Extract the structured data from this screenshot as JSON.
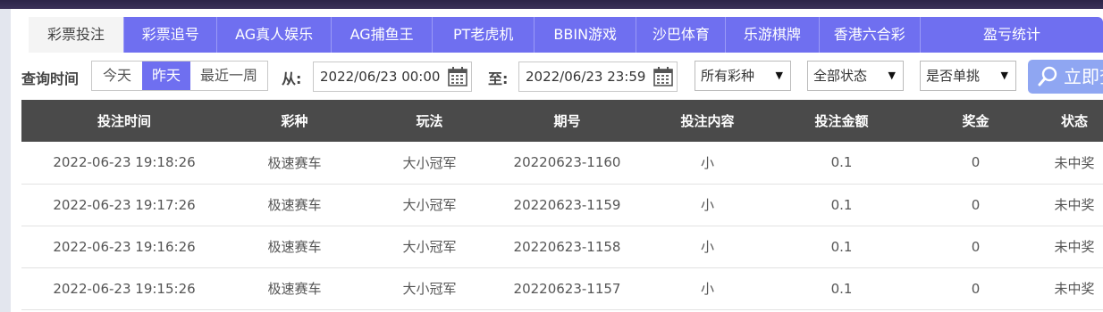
{
  "tabs": [
    {
      "label": "彩票投注",
      "active": true
    },
    {
      "label": "彩票追号",
      "active": false
    },
    {
      "label": "AG真人娱乐",
      "active": false
    },
    {
      "label": "AG捕鱼王",
      "active": false
    },
    {
      "label": "PT老虎机",
      "active": false
    },
    {
      "label": "BBIN游戏",
      "active": false
    },
    {
      "label": "沙巴体育",
      "active": false
    },
    {
      "label": "乐游棋牌",
      "active": false
    },
    {
      "label": "香港六合彩",
      "active": false
    },
    {
      "label": "盈亏统计",
      "active": false
    }
  ],
  "filter": {
    "query_time_label": "查询时间",
    "ranges": [
      {
        "label": "今天",
        "selected": false
      },
      {
        "label": "昨天",
        "selected": true
      },
      {
        "label": "最近一周",
        "selected": false
      }
    ],
    "from_label": "从:",
    "from_value": "2022/06/23 00:00",
    "to_label": "至:",
    "to_value": "2022/06/23 23:59",
    "lottery_type": "所有彩种",
    "status": "全部状态",
    "single_pick": "是否单挑",
    "search_label": "立即查"
  },
  "table": {
    "headers": [
      "投注时间",
      "彩种",
      "玩法",
      "期号",
      "投注内容",
      "投注金额",
      "奖金",
      "状态"
    ],
    "rows": [
      [
        "2022-06-23 19:18:26",
        "极速赛车",
        "大小冠军",
        "20220623-1160",
        "小",
        "0.1",
        "0",
        "未中奖"
      ],
      [
        "2022-06-23 19:17:26",
        "极速赛车",
        "大小冠军",
        "20220623-1159",
        "小",
        "0.1",
        "0",
        "未中奖"
      ],
      [
        "2022-06-23 19:16:26",
        "极速赛车",
        "大小冠军",
        "20220623-1158",
        "小",
        "0.1",
        "0",
        "未中奖"
      ],
      [
        "2022-06-23 19:15:26",
        "极速赛车",
        "大小冠军",
        "20220623-1157",
        "小",
        "0.1",
        "0",
        "未中奖"
      ]
    ]
  },
  "colors": {
    "accent": "#6f6ff0",
    "header_bg": "#4a4a4a",
    "search_button": "#8fa6f2"
  },
  "icons": {
    "calendar": "calendar-icon",
    "search": "search-icon",
    "dropdown": "triangle-down"
  }
}
